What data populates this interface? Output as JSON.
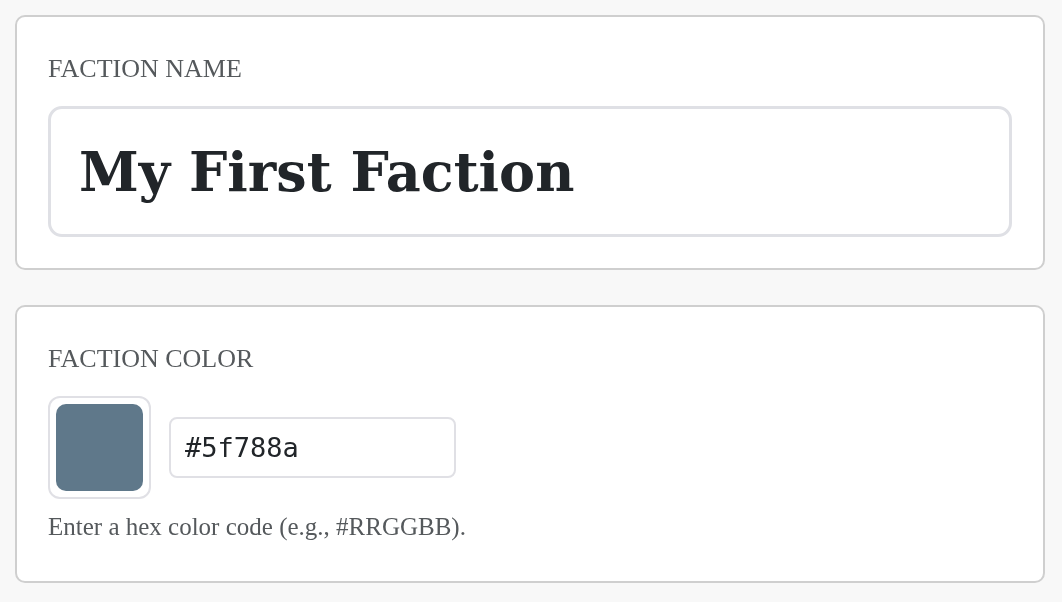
{
  "faction_name": {
    "label": "FACTION NAME",
    "value": "My First Faction"
  },
  "faction_color": {
    "label": "FACTION COLOR",
    "color": "#5f788a",
    "value": "#5f788a",
    "help": "Enter a hex color code (e.g., #RRGGBB)."
  }
}
